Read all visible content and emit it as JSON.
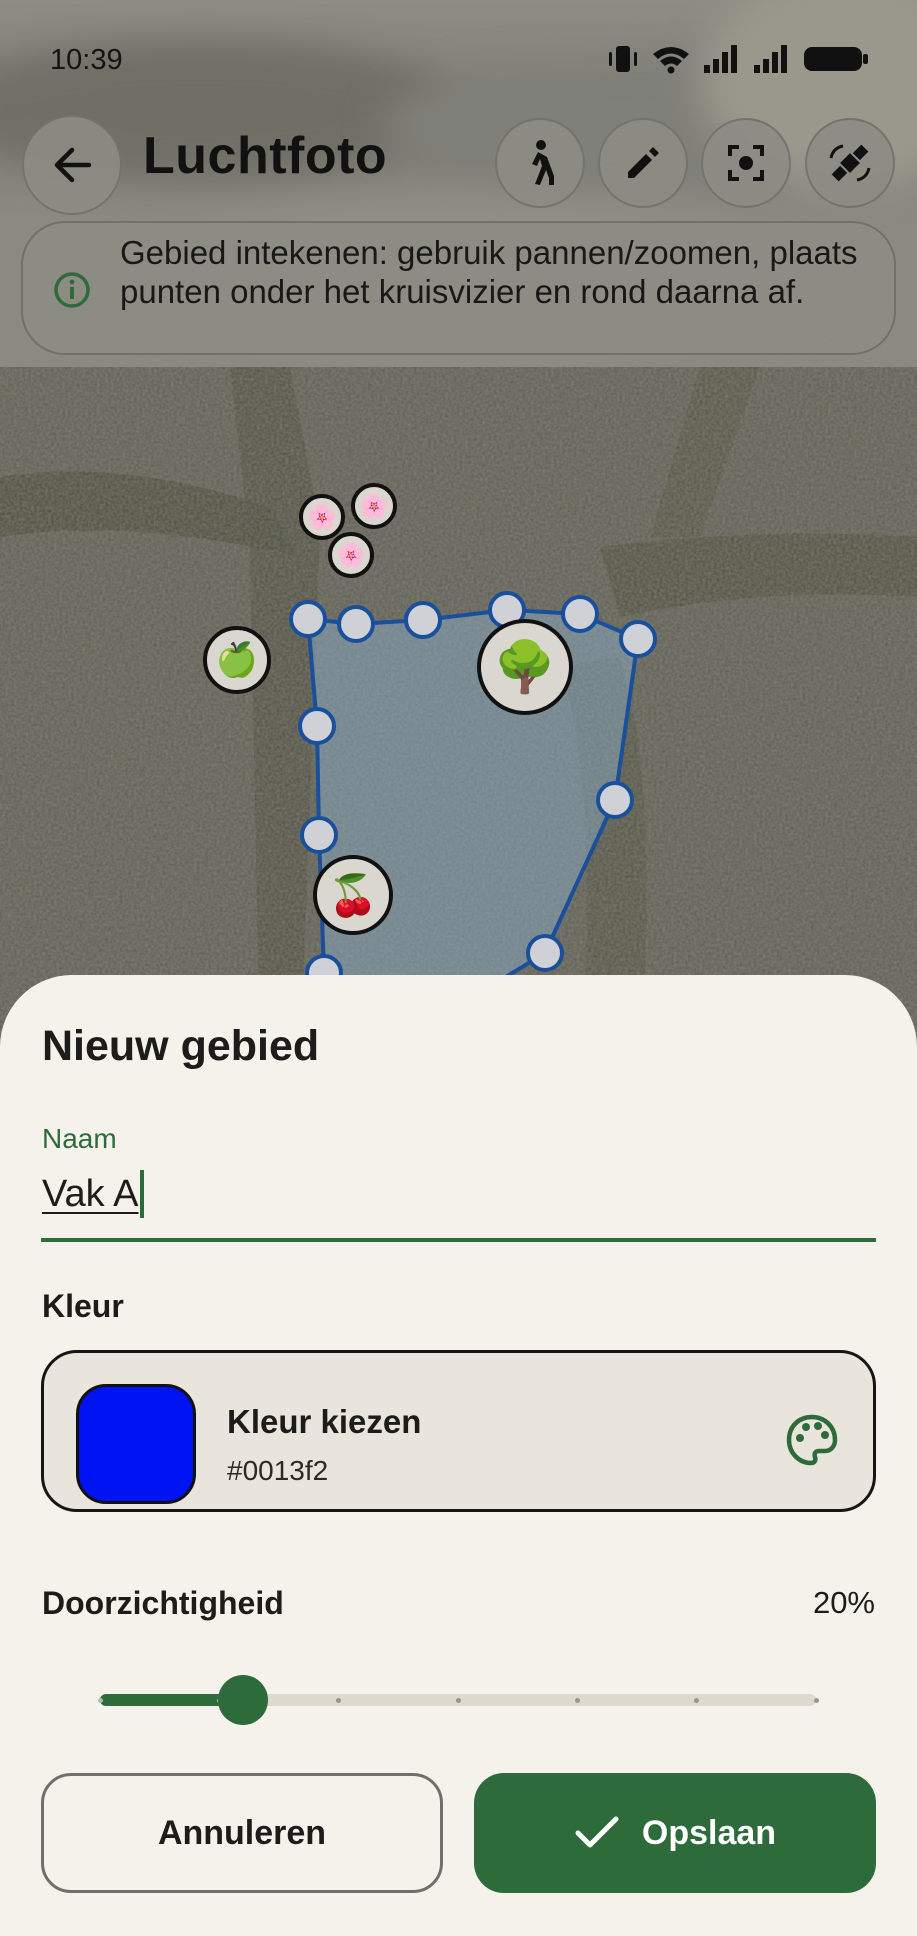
{
  "status_bar": {
    "time": "10:39",
    "icons": [
      "vibrate-icon",
      "wifi-icon",
      "signal-icon",
      "signal-icon",
      "battery-icon"
    ]
  },
  "header": {
    "title": "Luchtfoto",
    "back_icon": "arrow-left-icon",
    "actions": [
      "walk-icon",
      "pencil-icon",
      "focus-icon",
      "satellite-icon"
    ]
  },
  "info_banner": {
    "icon": "info-icon",
    "text": "Gebied intekenen: gebruik pannen/zoomen, plaats punten onder het kruisvizier en rond daarna af."
  },
  "map": {
    "markers": [
      "🌸",
      "🌸",
      "🌸",
      "🍏",
      "🌳",
      "🍒"
    ],
    "polygon_color": "#1a4f9c"
  },
  "sheet": {
    "title": "Nieuw gebied",
    "name_label": "Naam",
    "name_value": "Vak A",
    "color_section_label": "Kleur",
    "color_picker_title": "Kleur kiezen",
    "color_hex": "#0013f2",
    "opacity_label": "Doorzichtigheid",
    "opacity_display": "20%",
    "opacity_fraction": 0.2,
    "cancel_label": "Annuleren",
    "save_label": "Opslaan",
    "accent_color": "#2e6b3b"
  }
}
